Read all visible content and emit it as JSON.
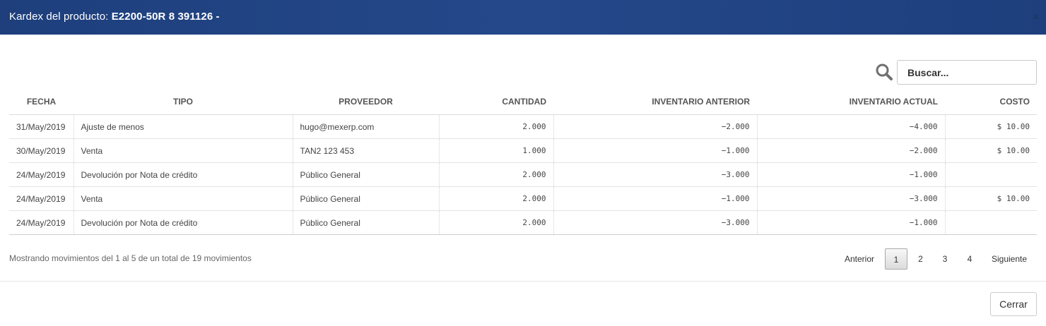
{
  "modal": {
    "title_prefix": "Kardex del producto: ",
    "title_product": "E2200-50R 8 391126 -",
    "close_glyph": "×"
  },
  "search": {
    "placeholder": "Buscar..."
  },
  "table": {
    "headers": [
      "FECHA",
      "TIPO",
      "PROVEEDOR",
      "CANTIDAD",
      "INVENTARIO ANTERIOR",
      "INVENTARIO ACTUAL",
      "COSTO"
    ],
    "rows": [
      [
        "31/May/2019",
        "Ajuste de menos",
        "hugo@mexerp.com",
        "2.000",
        "−2.000",
        "−4.000",
        "$ 10.00"
      ],
      [
        "30/May/2019",
        "Venta",
        "TAN2 123 453",
        "1.000",
        "−1.000",
        "−2.000",
        "$ 10.00"
      ],
      [
        "24/May/2019",
        "Devolución por Nota de crédito",
        "Público General",
        "2.000",
        "−3.000",
        "−1.000",
        ""
      ],
      [
        "24/May/2019",
        "Venta",
        "Público General",
        "2.000",
        "−1.000",
        "−3.000",
        "$ 10.00"
      ],
      [
        "24/May/2019",
        "Devolución por Nota de crédito",
        "Público General",
        "2.000",
        "−3.000",
        "−1.000",
        ""
      ]
    ]
  },
  "footer": {
    "info": "Mostrando movimientos del 1 al 5 de un total de 19 movimientos",
    "prev": "Anterior",
    "pages": [
      "1",
      "2",
      "3",
      "4"
    ],
    "active_page": "1",
    "next": "Siguiente"
  },
  "actions": {
    "close_label": "Cerrar"
  }
}
